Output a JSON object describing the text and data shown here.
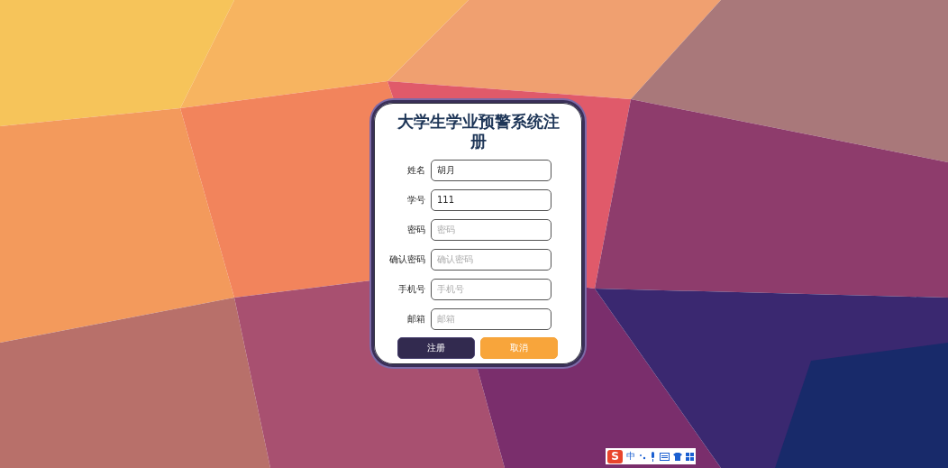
{
  "form": {
    "title": "大学生学业预警系统注册",
    "fields": [
      {
        "label": "姓名",
        "value": "胡月"
      },
      {
        "label": "学号",
        "value": "111"
      },
      {
        "label": "密码",
        "placeholder": "密码"
      },
      {
        "label": "确认密码",
        "placeholder": "确认密码"
      },
      {
        "label": "手机号",
        "placeholder": "手机号"
      },
      {
        "label": "邮箱",
        "placeholder": "邮箱"
      }
    ],
    "buttons": [
      {
        "label": "注册",
        "kind": "primary"
      },
      {
        "label": "取消",
        "kind": "secondary"
      }
    ]
  },
  "ime_bar": {
    "logo": "S",
    "mode": "中"
  }
}
